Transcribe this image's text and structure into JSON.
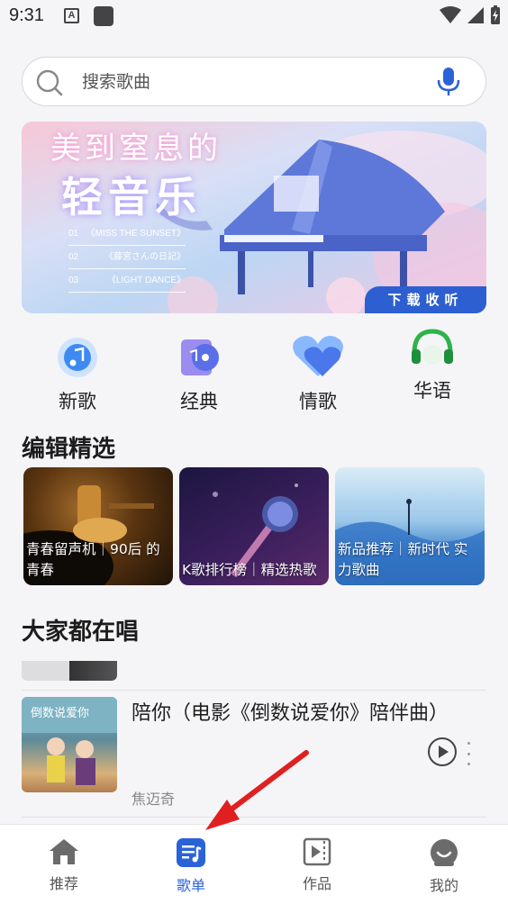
{
  "status": {
    "time": "9:31",
    "notification_letter": "A"
  },
  "search": {
    "placeholder": "搜索歌曲"
  },
  "banner": {
    "title_top": "美到窒息的",
    "title_main": "轻音乐",
    "tracks": [
      {
        "num": "01",
        "name": "《MISS THE SUNSET》"
      },
      {
        "num": "02",
        "name": "《藤宮さんの日記》"
      },
      {
        "num": "03",
        "name": "《LIGHT DANCE》"
      }
    ],
    "button_label": "下载收听"
  },
  "categories": [
    {
      "label": "新歌",
      "icon": "music-note-icon"
    },
    {
      "label": "经典",
      "icon": "vinyl-record-icon"
    },
    {
      "label": "情歌",
      "icon": "heart-icon"
    },
    {
      "label": "华语",
      "icon": "headphones-icon"
    }
  ],
  "editors_pick": {
    "title": "编辑精选",
    "cards": [
      {
        "caption": "青春留声机｜90后 的青春"
      },
      {
        "caption": "K歌排行榜｜精选热歌"
      },
      {
        "caption": "新品推荐｜新时代 实力歌曲"
      }
    ]
  },
  "everyone_sings": {
    "title": "大家都在唱",
    "song": {
      "title": "陪你（电影《倒数说爱你》陪伴曲）",
      "artist": "焦迈奇"
    }
  },
  "bottom_nav": [
    {
      "label": "推荐",
      "icon": "home-icon",
      "active": false
    },
    {
      "label": "歌单",
      "icon": "playlist-icon",
      "active": true
    },
    {
      "label": "作品",
      "icon": "video-works-icon",
      "active": false
    },
    {
      "label": "我的",
      "icon": "profile-icon",
      "active": false
    }
  ],
  "colors": {
    "accent": "#2a62d8",
    "annotation_arrow": "#e02020"
  }
}
